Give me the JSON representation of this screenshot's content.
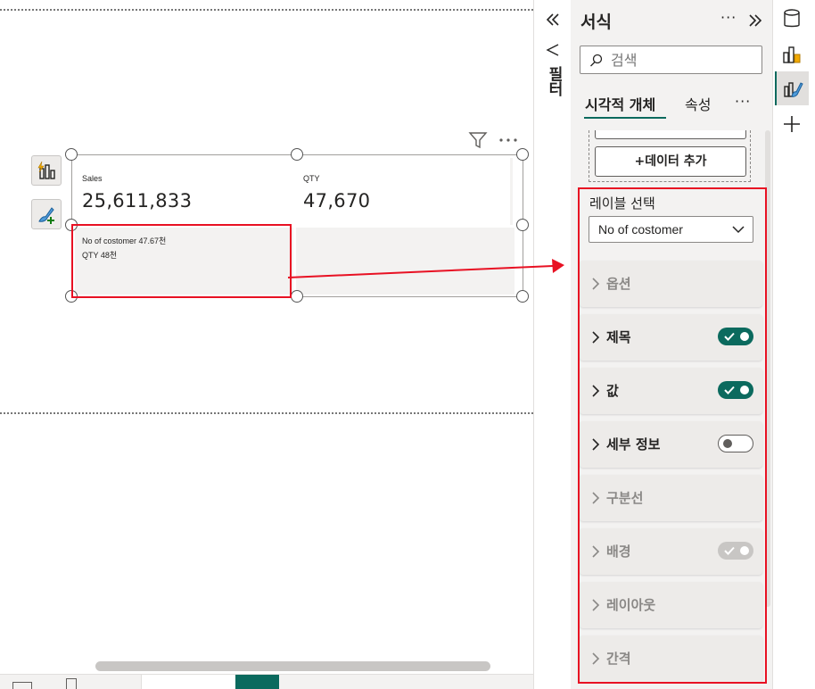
{
  "canvas": {
    "cards": [
      {
        "label": "Sales",
        "value": "25,611,833"
      },
      {
        "label": "QTY",
        "value": "47,670"
      }
    ],
    "detail_lines": [
      "No of costomer 47.67천",
      "QTY 48천"
    ],
    "side_buttons": [
      {
        "icon": "smart-narrative-chart-icon"
      },
      {
        "icon": "format-brush-plus-icon"
      }
    ],
    "header_icons": [
      "filter-icon",
      "more-options-icon"
    ]
  },
  "filter_pane": {
    "label": "필터",
    "expand_icon": "double-chevron-left-icon",
    "funnel_icon": "filter-funnel-icon"
  },
  "format_pane": {
    "title": "서식",
    "more": "···",
    "collapse_icon": "double-chevron-right-icon",
    "search": {
      "placeholder": "검색",
      "value": ""
    },
    "tabs": [
      {
        "label": "시각적 개체",
        "selected": true
      },
      {
        "label": "속성",
        "selected": false
      }
    ],
    "tabs_more": "···",
    "add_data_label": "+데이터 추가",
    "label_select": {
      "caption": "레이블 선택",
      "value": "No of costomer"
    },
    "sections": [
      {
        "label": "옵션",
        "dimmed": true,
        "toggle": null
      },
      {
        "label": "제목",
        "dimmed": false,
        "toggle": "on"
      },
      {
        "label": "값",
        "dimmed": false,
        "toggle": "on"
      },
      {
        "label": "세부 정보",
        "dimmed": false,
        "toggle": "off"
      },
      {
        "label": "구분선",
        "dimmed": true,
        "toggle": null
      },
      {
        "label": "배경",
        "dimmed": true,
        "toggle": "disabled"
      },
      {
        "label": "레이아웃",
        "dimmed": true,
        "toggle": null
      },
      {
        "label": "간격",
        "dimmed": true,
        "toggle": null
      }
    ]
  },
  "rail": {
    "buttons": [
      {
        "icon": "data-cylinder-icon",
        "selected": false
      },
      {
        "icon": "build-visual-icon",
        "selected": false
      },
      {
        "icon": "format-visual-icon",
        "selected": true
      },
      {
        "icon": "plus-icon",
        "selected": false
      }
    ]
  },
  "colors": {
    "accent": "#0b6a5e",
    "annotation": "#e81123",
    "pane_bg": "#f3f2f1"
  }
}
